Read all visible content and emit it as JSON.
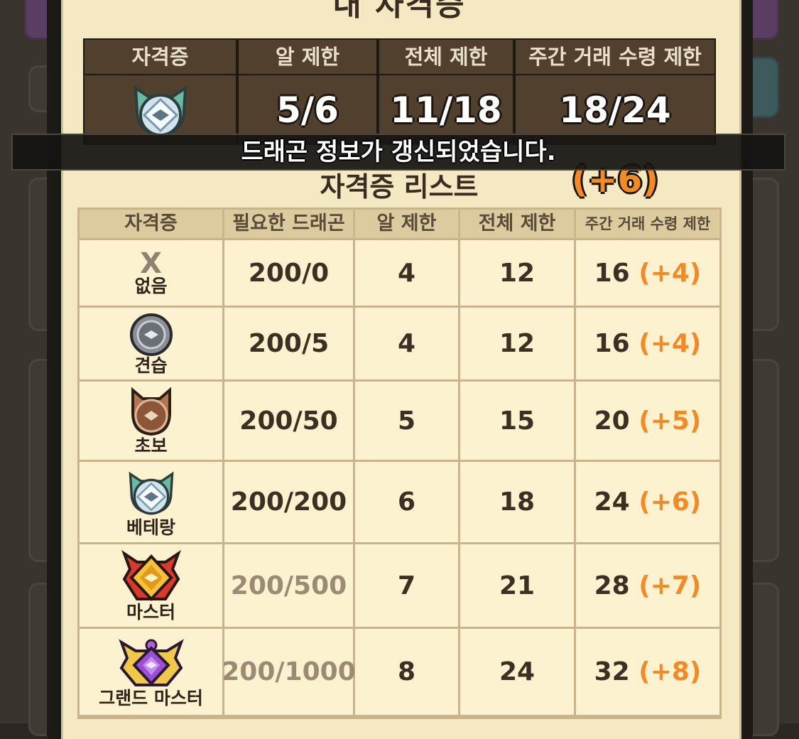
{
  "popup": {
    "title": "내 자격증"
  },
  "my_license": {
    "headers": [
      "자격증",
      "알 제한",
      "전체 제한",
      "주간 거래 수령 제한"
    ],
    "badge_icon": "veteran-badge-icon",
    "egg_limit": "5/6",
    "total_limit": "11/18",
    "weekly_limit": "18/24",
    "weekly_bonus": "(+6)"
  },
  "toast": {
    "message": "드래곤 정보가 갱신되었습니다."
  },
  "license_list": {
    "title": "자격증 리스트",
    "headers": [
      "자격증",
      "필요한 드래곤",
      "알 제한",
      "전체 제한",
      "주간 거래 수령 제한"
    ],
    "rows": [
      {
        "icon": "x-mark",
        "name": "없음",
        "required": "200/0",
        "egg": "4",
        "total": "12",
        "weekly": "16",
        "bonus": "(+4)"
      },
      {
        "icon": "apprentice-badge-icon",
        "name": "견습",
        "required": "200/5",
        "egg": "4",
        "total": "12",
        "weekly": "16",
        "bonus": "(+4)"
      },
      {
        "icon": "beginner-badge-icon",
        "name": "초보",
        "required": "200/50",
        "egg": "5",
        "total": "15",
        "weekly": "20",
        "bonus": "(+5)"
      },
      {
        "icon": "veteran-badge-icon",
        "name": "베테랑",
        "required": "200/200",
        "egg": "6",
        "total": "18",
        "weekly": "24",
        "bonus": "(+6)"
      },
      {
        "icon": "master-badge-icon",
        "name": "마스터",
        "required": "200/500",
        "egg": "7",
        "total": "21",
        "weekly": "28",
        "bonus": "(+7)"
      },
      {
        "icon": "grand-master-badge-icon",
        "name": "그랜드 마스터",
        "required": "200/1000",
        "egg": "8",
        "total": "24",
        "weekly": "32",
        "bonus": "(+8)"
      }
    ]
  },
  "colors": {
    "panel": "#f4e9c2",
    "header_dark": "#51402e",
    "bonus_orange": "#f28b26",
    "muted_text": "#9b8b73"
  }
}
